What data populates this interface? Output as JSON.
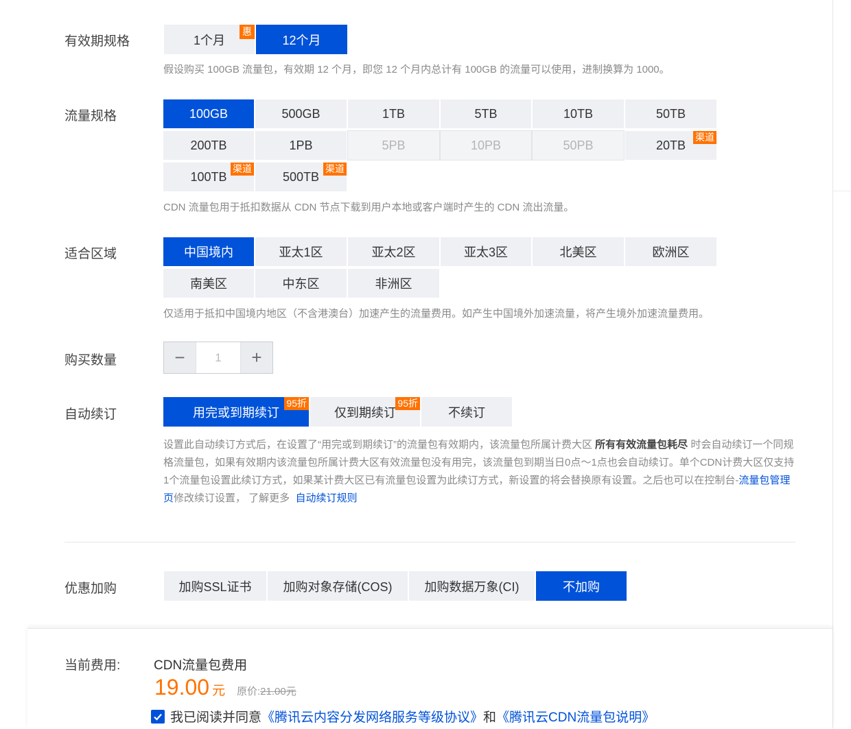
{
  "validity": {
    "label": "有效期规格",
    "options": [
      {
        "label": "1个月",
        "badge": "惠",
        "selected": false
      },
      {
        "label": "12个月",
        "badge": "",
        "selected": true
      }
    ],
    "hint": "假设购买 100GB 流量包，有效期 12 个月，即您 12 个月内总计有 100GB 的流量可以使用，进制换算为 1000。"
  },
  "traffic": {
    "label": "流量规格",
    "options": [
      {
        "label": "100GB",
        "selected": true
      },
      {
        "label": "500GB"
      },
      {
        "label": "1TB"
      },
      {
        "label": "5TB"
      },
      {
        "label": "10TB"
      },
      {
        "label": "50TB"
      },
      {
        "label": "200TB"
      },
      {
        "label": "1PB"
      },
      {
        "label": "5PB",
        "disabled": true
      },
      {
        "label": "10PB",
        "disabled": true
      },
      {
        "label": "50PB",
        "disabled": true
      },
      {
        "label": "20TB",
        "badge": "渠道"
      },
      {
        "label": "100TB",
        "badge": "渠道"
      },
      {
        "label": "500TB",
        "badge": "渠道"
      }
    ],
    "hint": "CDN 流量包用于抵扣数据从 CDN 节点下载到用户本地或客户端时产生的 CDN 流出流量。"
  },
  "region": {
    "label": "适合区域",
    "options": [
      {
        "label": "中国境内",
        "selected": true
      },
      {
        "label": "亚太1区"
      },
      {
        "label": "亚太2区"
      },
      {
        "label": "亚太3区"
      },
      {
        "label": "北美区"
      },
      {
        "label": "欧洲区"
      },
      {
        "label": "南美区"
      },
      {
        "label": "中东区"
      },
      {
        "label": "非洲区"
      }
    ],
    "hint": "仅适用于抵扣中国境内地区（不含港澳台）加速产生的流量费用。如产生中国境外加速流量，将产生境外加速流量费用。"
  },
  "quantity": {
    "label": "购买数量",
    "minus": "−",
    "plus": "+",
    "value": "1"
  },
  "renew": {
    "label": "自动续订",
    "options": [
      {
        "label": "用完或到期续订",
        "badge": "95折",
        "selected": true
      },
      {
        "label": "仅到期续订",
        "badge": "95折"
      },
      {
        "label": "不续订"
      }
    ],
    "hint_part1": "设置此自动续订方式后，在设置了“用完或到期续订”的流量包有效期内，该流量包所属计费大区 ",
    "hint_bold": "所有有效流量包耗尽",
    "hint_part2": " 时会自动续订一个同规格流量包，如果有效期内该流量包所属计费大区有效流量包没有用完，该流量包到期当日0点～1点也会自动续订。单个CDN计费大区仅支持1个流量包设置此续订方式，如果某计费大区已有流量包设置为此续订方式，新设置的将会替换原有设置。之后也可以在控制台-",
    "hint_link1": "流量包管理页",
    "hint_part3": "修改续订设置， 了解更多 ",
    "hint_link2": "自动续订规则"
  },
  "addon": {
    "label": "优惠加购",
    "options": [
      {
        "label": "加购SSL证书"
      },
      {
        "label": "加购对象存储(COS)"
      },
      {
        "label": "加购数据万象(CI)"
      },
      {
        "label": "不加购",
        "selected": true
      }
    ]
  },
  "footer": {
    "fee_label": "当前费用:",
    "fee_name": "CDN流量包费用",
    "price": "19.00",
    "unit": "元",
    "orig_prefix": "原价:",
    "orig_value": "21.00元",
    "agree_text": "我已阅读并同意",
    "link1": "《腾讯云内容分发网络服务等级协议》",
    "and": "和",
    "link2": "《腾讯云CDN流量包说明》"
  },
  "colors": {
    "primary": "#0052d9",
    "badge": "#ff7200",
    "price": "#ff7200"
  }
}
